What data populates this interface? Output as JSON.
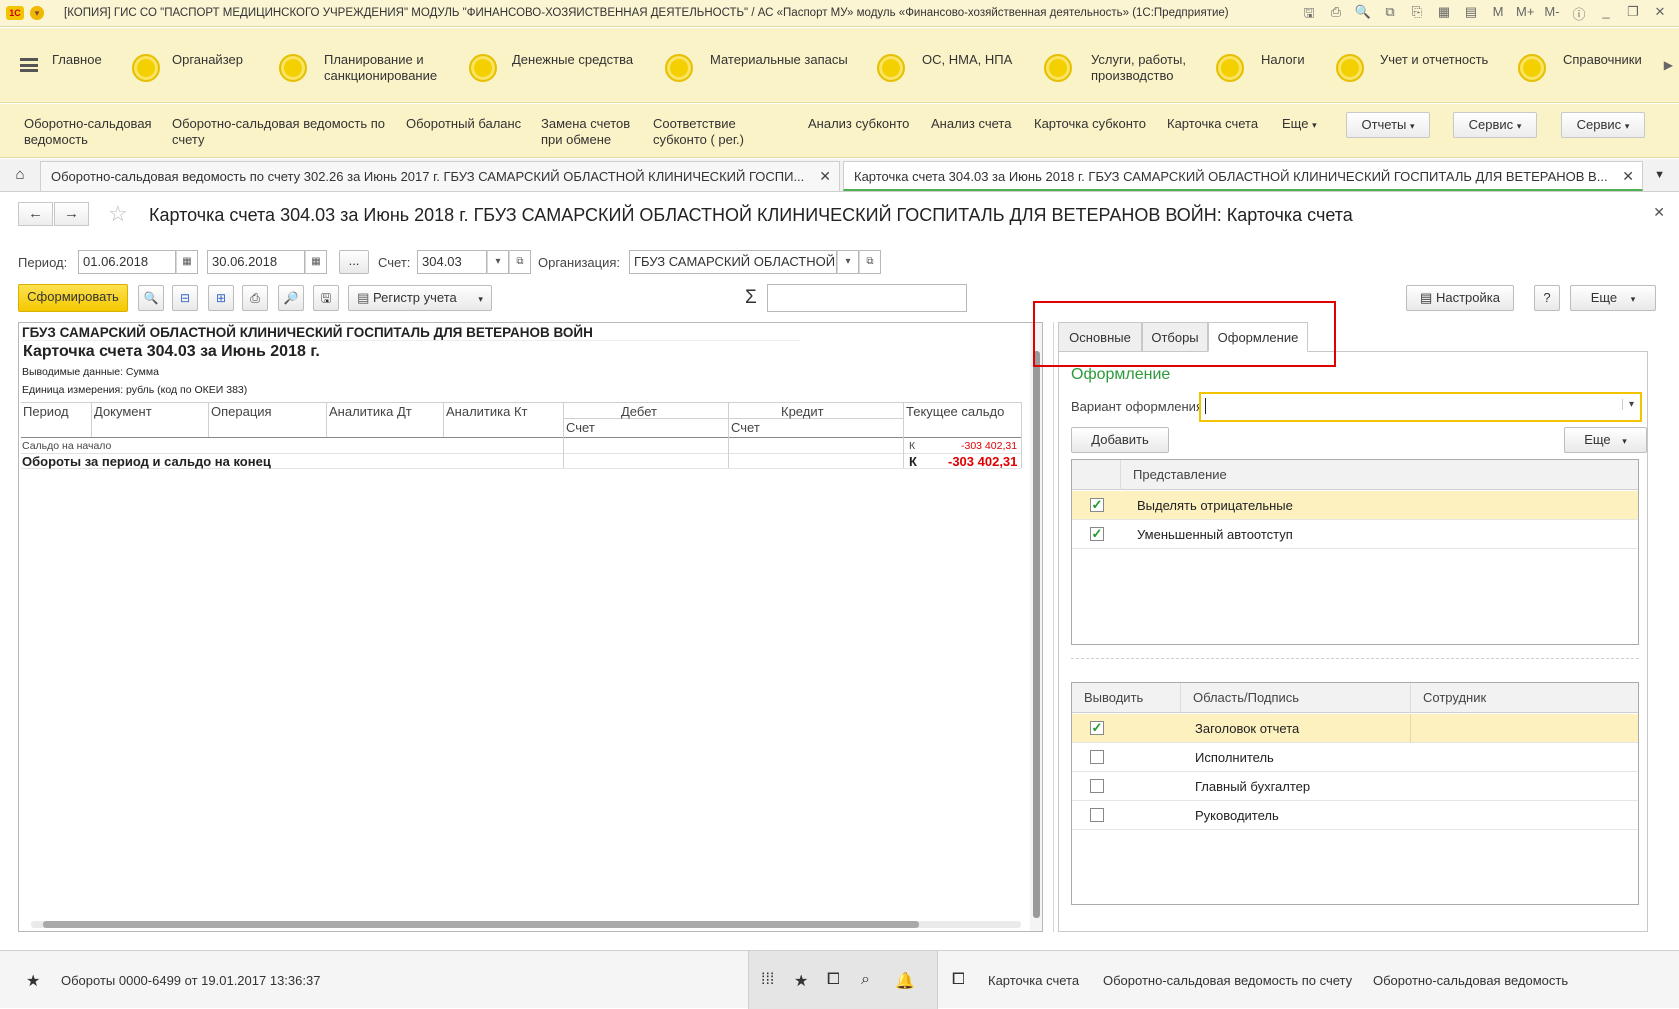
{
  "window": {
    "logo": "1С",
    "title": "[КОПИЯ] ГИС СО \"ПАСПОРТ МЕДИЦИНСКОГО УЧРЕЖДЕНИЯ\" МОДУЛЬ \"ФИНАНСОВО-ХОЗЯЙСТВЕННАЯ ДЕЯТЕЛЬНОСТЬ\" / АС «Паспорт МУ» модуль «Финансово-хозяйственная деятельность» (1С:Предприятие)"
  },
  "sections": [
    {
      "label": "Главное"
    },
    {
      "label": "Органайзер"
    },
    {
      "label": "Планирование и санкционирование"
    },
    {
      "label": "Денежные средства"
    },
    {
      "label": "Материальные запасы"
    },
    {
      "label": "ОС, НМА, НПА"
    },
    {
      "label": "Услуги, работы, производство"
    },
    {
      "label": "Налоги"
    },
    {
      "label": "Учет и отчетность"
    },
    {
      "label": "Справочники"
    }
  ],
  "commands": [
    {
      "label": "Оборотно-сальдовая ведомость"
    },
    {
      "label": "Оборотно-сальдовая ведомость по счету"
    },
    {
      "label": "Оборотный баланс"
    },
    {
      "label": "Замена счетов при обмене"
    },
    {
      "label": "Соответствие субконто ( рег.)"
    },
    {
      "label": "Анализ субконто"
    },
    {
      "label": "Анализ счета"
    },
    {
      "label": "Карточка субконто"
    },
    {
      "label": "Карточка счета"
    },
    {
      "label": "Еще"
    }
  ],
  "command_buttons": {
    "reports": "Отчеты",
    "service1": "Сервис",
    "service2": "Сервис"
  },
  "tabs": [
    {
      "label": "Оборотно-сальдовая ведомость по счету 302.26 за Июнь 2017 г. ГБУЗ САМАРСКИЙ ОБЛАСТНОЙ КЛИНИЧЕСКИЙ ГОСПИ..."
    },
    {
      "label": "Карточка счета 304.03 за Июнь 2018 г. ГБУЗ САМАРСКИЙ ОБЛАСТНОЙ КЛИНИЧЕСКИЙ ГОСПИТАЛЬ ДЛЯ ВЕТЕРАНОВ В..."
    }
  ],
  "form": {
    "title": "Карточка счета 304.03 за Июнь 2018 г. ГБУЗ САМАРСКИЙ ОБЛАСТНОЙ КЛИНИЧЕСКИЙ ГОСПИТАЛЬ ДЛЯ ВЕТЕРАНОВ ВОЙН: Карточка счета",
    "period_label": "Период:",
    "date_from": "01.06.2018",
    "date_to": "30.06.2018",
    "ellipsis": "...",
    "account_label": "Счет:",
    "account": "304.03",
    "org_label": "Организация:",
    "org": "ГБУЗ САМАРСКИЙ ОБЛАСТНОЙ",
    "generate": "Сформировать",
    "register": "Регистр учета",
    "sigma": "Σ",
    "settings": "Настройка",
    "help": "?",
    "more": "Еще"
  },
  "report": {
    "org": "ГБУЗ САМАРСКИЙ ОБЛАСТНОЙ КЛИНИЧЕСКИЙ ГОСПИТАЛЬ ДЛЯ ВЕТЕРАНОВ ВОЙН",
    "title": "Карточка счета 304.03 за Июнь 2018 г.",
    "data_line": "Выводимые данные:  Сумма",
    "unit_line": "Единица измерения: рубль (код по ОКЕИ 383)",
    "columns": {
      "period": "Период",
      "document": "Документ",
      "operation": "Операция",
      "an_dt": "Аналитика Дт",
      "an_kt": "Аналитика Кт",
      "debit": "Дебет",
      "credit": "Кредит",
      "balance": "Текущее сальдо",
      "acc1": "Счет",
      "acc2": "Счет"
    },
    "opening_label": "Сальдо на начало",
    "opening_side": "К",
    "opening_value": "-303 402,31",
    "closing_label": "Обороты за период и сальдо на конец",
    "closing_side": "К",
    "closing_value": "-303 402,31"
  },
  "panel": {
    "tabs": [
      "Основные",
      "Отборы",
      "Оформление"
    ],
    "section_title": "Оформление",
    "variant_label": "Вариант оформления:",
    "variant_value": "",
    "add": "Добавить",
    "more": "Еще",
    "table1": {
      "header": "Представление",
      "rows": [
        {
          "label": "Выделять отрицательные",
          "checked": true
        },
        {
          "label": "Уменьшенный автоотступ",
          "checked": true
        }
      ]
    },
    "table2": {
      "headers": [
        "Выводить",
        "Область/Подпись",
        "Сотрудник"
      ],
      "rows": [
        {
          "label": "Заголовок отчета",
          "checked": true
        },
        {
          "label": "Исполнитель",
          "checked": false
        },
        {
          "label": "Главный бухгалтер",
          "checked": false
        },
        {
          "label": "Руководитель",
          "checked": false
        }
      ]
    }
  },
  "status": {
    "left": "Обороты 0000-6499 от 19.01.2017 13:36:37",
    "links": [
      "Карточка счета",
      "Оборотно-сальдовая ведомость по счету",
      "Оборотно-сальдовая ведомость"
    ]
  },
  "colors": {
    "accent_yellow": "#f4c800",
    "negative_red": "#e00000",
    "section_green": "#2c9a3a"
  }
}
